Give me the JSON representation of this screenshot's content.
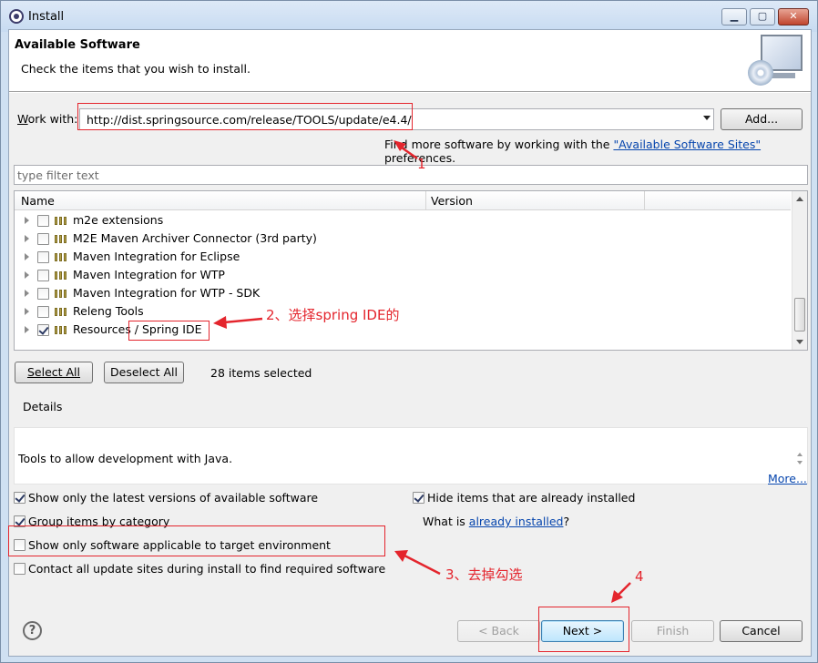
{
  "window": {
    "title": "Install",
    "minimize": "▁",
    "maximize": "▢",
    "close": "✕"
  },
  "header": {
    "title": "Available Software",
    "subtitle": "Check the items that you wish to install.",
    "icon": "monitor-cd-icon"
  },
  "work_with": {
    "label": "Work with:",
    "label_mnemonic": "W",
    "label_rest": "ork with:",
    "value": "http://dist.springsource.com/release/TOOLS/update/e4.4/",
    "add_button": "Add...",
    "find_more_prefix": "Find more software by working with the ",
    "find_more_link": "\"Available Software Sites\"",
    "find_more_suffix": " preferences."
  },
  "filter": {
    "placeholder": "type filter text"
  },
  "table": {
    "columns": [
      "Name",
      "Version"
    ],
    "rows": [
      {
        "name": "m2e extensions",
        "checked": false
      },
      {
        "name": "M2E Maven Archiver Connector (3rd party)",
        "checked": false
      },
      {
        "name": "Maven Integration for Eclipse",
        "checked": false
      },
      {
        "name": "Maven Integration for WTP",
        "checked": false
      },
      {
        "name": "Maven Integration for WTP - SDK",
        "checked": false
      },
      {
        "name": "Releng Tools",
        "checked": false
      },
      {
        "name": "Resources / Spring IDE",
        "checked": true
      }
    ]
  },
  "selection": {
    "select_all": "Select All",
    "deselect_all": "Deselect All",
    "count_text": "28 items selected"
  },
  "details": {
    "heading": "Details",
    "text": "Tools to allow development with Java.",
    "more_link": "More..."
  },
  "options": {
    "latest_versions": {
      "label": "Show only the latest versions of available software",
      "checked": true
    },
    "hide_installed": {
      "label": "Hide items that are already installed",
      "checked": true
    },
    "group_by_category": {
      "label": "Group items by category",
      "checked": true
    },
    "what_is_prefix": "What is ",
    "already_installed_link": "already installed",
    "what_is_suffix": "?",
    "target_env": {
      "label": "Show only software applicable to target environment",
      "checked": false
    },
    "contact_sites": {
      "label": "Contact all update sites during install to find required software",
      "checked": false
    }
  },
  "footer": {
    "help": "?",
    "back": "< Back",
    "next": "Next >",
    "finish": "Finish",
    "cancel": "Cancel"
  },
  "annotations": {
    "a1": "1",
    "a2": "2、选择spring IDE的",
    "a3": "3、去掉勾选",
    "a4": "4",
    "color": "#e4252d"
  }
}
